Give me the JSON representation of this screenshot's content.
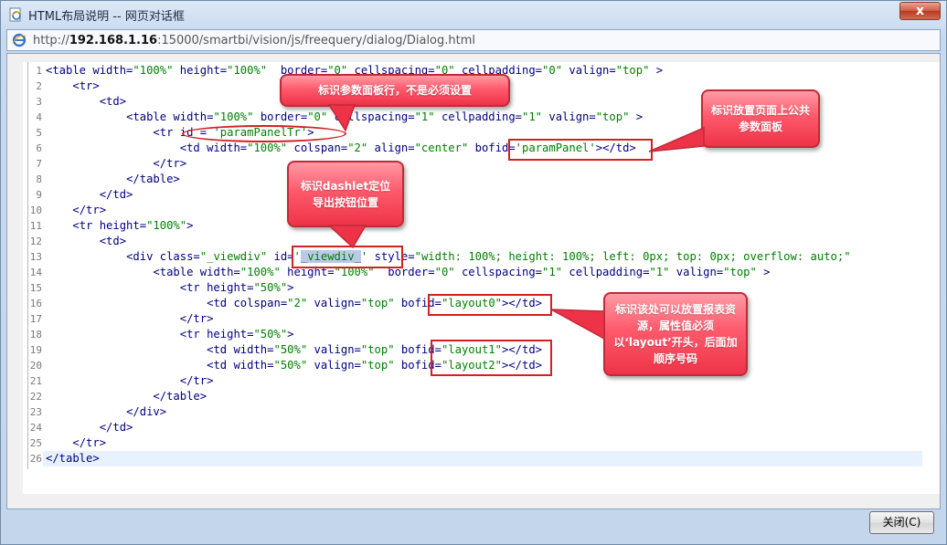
{
  "window": {
    "title": "HTML布局说明 -- 网页对话框",
    "close_label": "x"
  },
  "address": {
    "protocol_host_prefix": "http://",
    "host": "192.168.1.16",
    "path": ":15000/smartbi/vision/js/freequery/dialog/Dialog.html"
  },
  "code_lines": [
    {
      "n": "1",
      "indent": "",
      "parts": [
        [
          "t",
          "<table width="
        ],
        [
          "s",
          "\"100%\""
        ],
        [
          "t",
          " height="
        ],
        [
          "s",
          "\"100%\""
        ],
        [
          "t",
          "  border="
        ],
        [
          "s",
          "\"0\""
        ],
        [
          "t",
          " cellspacing="
        ],
        [
          "s",
          "\"0\""
        ],
        [
          "t",
          " cellpadding="
        ],
        [
          "s",
          "\"0\""
        ],
        [
          "t",
          " valign="
        ],
        [
          "s",
          "\"top\""
        ],
        [
          "t",
          " >"
        ]
      ]
    },
    {
      "n": "2",
      "indent": "    ",
      "parts": [
        [
          "t",
          "<tr>"
        ]
      ]
    },
    {
      "n": "3",
      "indent": "        ",
      "parts": [
        [
          "t",
          "<td>"
        ]
      ]
    },
    {
      "n": "4",
      "indent": "            ",
      "parts": [
        [
          "t",
          "<table width="
        ],
        [
          "s",
          "\"100%\""
        ],
        [
          "t",
          " border="
        ],
        [
          "s",
          "\"0\""
        ],
        [
          "t",
          " cellspacing="
        ],
        [
          "s",
          "\"1\""
        ],
        [
          "t",
          " cellpadding="
        ],
        [
          "s",
          "\"1\""
        ],
        [
          "t",
          " valign="
        ],
        [
          "s",
          "\"top\""
        ],
        [
          "t",
          " >"
        ]
      ]
    },
    {
      "n": "5",
      "indent": "                ",
      "parts": [
        [
          "t",
          "<tr id = "
        ],
        [
          "s",
          "'paramPanelTr'"
        ],
        [
          "t",
          ">"
        ]
      ]
    },
    {
      "n": "6",
      "indent": "                    ",
      "parts": [
        [
          "t",
          "<td width="
        ],
        [
          "s",
          "\"100%\""
        ],
        [
          "t",
          " colspan="
        ],
        [
          "s",
          "\"2\""
        ],
        [
          "t",
          " align="
        ],
        [
          "s",
          "\"center\""
        ],
        [
          "t",
          " bofid="
        ],
        [
          "s",
          "'paramPanel'"
        ],
        [
          "t",
          "></td>"
        ]
      ]
    },
    {
      "n": "7",
      "indent": "                ",
      "parts": [
        [
          "t",
          "</tr>"
        ]
      ]
    },
    {
      "n": "8",
      "indent": "            ",
      "parts": [
        [
          "t",
          "</table>"
        ]
      ]
    },
    {
      "n": "9",
      "indent": "        ",
      "parts": [
        [
          "t",
          "</td>"
        ]
      ]
    },
    {
      "n": "10",
      "indent": "    ",
      "parts": [
        [
          "t",
          "</tr>"
        ]
      ]
    },
    {
      "n": "11",
      "indent": "    ",
      "parts": [
        [
          "t",
          "<tr height="
        ],
        [
          "s",
          "\"100%\""
        ],
        [
          "t",
          ">"
        ]
      ]
    },
    {
      "n": "12",
      "indent": "        ",
      "parts": [
        [
          "t",
          "<td>"
        ]
      ]
    },
    {
      "n": "13",
      "indent": "            ",
      "parts": [
        [
          "t",
          "<div class="
        ],
        [
          "s",
          "\"_viewdiv\""
        ],
        [
          "t",
          " id="
        ],
        [
          "s",
          "'"
        ],
        [
          "x",
          "_viewdiv_"
        ],
        [
          "s",
          "'"
        ],
        [
          "t",
          " style="
        ],
        [
          "s",
          "\"width: 100%; height: 100%; left: 0px; top: 0px; overflow: auto;\""
        ]
      ]
    },
    {
      "n": "14",
      "indent": "                ",
      "parts": [
        [
          "t",
          "<table width="
        ],
        [
          "s",
          "\"100%\""
        ],
        [
          "t",
          " height="
        ],
        [
          "s",
          "\"100%\""
        ],
        [
          "t",
          "  border="
        ],
        [
          "s",
          "\"0\""
        ],
        [
          "t",
          " cellspacing="
        ],
        [
          "s",
          "\"1\""
        ],
        [
          "t",
          " cellpadding="
        ],
        [
          "s",
          "\"1\""
        ],
        [
          "t",
          " valign="
        ],
        [
          "s",
          "\"top\""
        ],
        [
          "t",
          " >"
        ]
      ]
    },
    {
      "n": "15",
      "indent": "                    ",
      "parts": [
        [
          "t",
          "<tr height="
        ],
        [
          "s",
          "\"50%\""
        ],
        [
          "t",
          ">"
        ]
      ]
    },
    {
      "n": "16",
      "indent": "                        ",
      "parts": [
        [
          "t",
          "<td colspan="
        ],
        [
          "s",
          "\"2\""
        ],
        [
          "t",
          " valign="
        ],
        [
          "s",
          "\"top\""
        ],
        [
          "t",
          " bofid="
        ],
        [
          "s",
          "\"layout0\""
        ],
        [
          "t",
          "></td>"
        ]
      ]
    },
    {
      "n": "17",
      "indent": "                    ",
      "parts": [
        [
          "t",
          "</tr>"
        ]
      ]
    },
    {
      "n": "18",
      "indent": "                    ",
      "parts": [
        [
          "t",
          "<tr height="
        ],
        [
          "s",
          "\"50%\""
        ],
        [
          "t",
          ">"
        ]
      ]
    },
    {
      "n": "19",
      "indent": "                        ",
      "parts": [
        [
          "t",
          "<td width="
        ],
        [
          "s",
          "\"50%\""
        ],
        [
          "t",
          " valign="
        ],
        [
          "s",
          "\"top\""
        ],
        [
          "t",
          " bofid="
        ],
        [
          "s",
          "\"layout1\""
        ],
        [
          "t",
          "></td>"
        ]
      ]
    },
    {
      "n": "20",
      "indent": "                        ",
      "parts": [
        [
          "t",
          "<td width="
        ],
        [
          "s",
          "\"50%\""
        ],
        [
          "t",
          " valign="
        ],
        [
          "s",
          "\"top\""
        ],
        [
          "t",
          " bofid="
        ],
        [
          "s",
          "\"layout2\""
        ],
        [
          "t",
          "></td>"
        ]
      ]
    },
    {
      "n": "21",
      "indent": "                    ",
      "parts": [
        [
          "t",
          "</tr>"
        ]
      ]
    },
    {
      "n": "22",
      "indent": "                ",
      "parts": [
        [
          "t",
          "</table>"
        ]
      ]
    },
    {
      "n": "23",
      "indent": "            ",
      "parts": [
        [
          "t",
          "</div>"
        ]
      ]
    },
    {
      "n": "24",
      "indent": "        ",
      "parts": [
        [
          "t",
          "</td>"
        ]
      ]
    },
    {
      "n": "25",
      "indent": "    ",
      "parts": [
        [
          "t",
          "</tr>"
        ]
      ]
    },
    {
      "n": "26",
      "indent": "",
      "parts": [
        [
          "t",
          "</table>"
        ]
      ]
    }
  ],
  "notes": {
    "param_row": "标识参数面板行，不是必须设置",
    "param_panel": "标识放置页面上公共参数面板",
    "dashlet": "标识dashlet定位导出按钮位置",
    "layout": "标识该处可以放置报表资源，属性值必须以‘layout’开头，后面加顺序号码"
  },
  "buttons": {
    "close": "关闭(C)"
  },
  "colors": {
    "tag": "#000080",
    "string": "#008000",
    "note_fill": "#ff5a6c",
    "highlight_border": "#d42020"
  }
}
